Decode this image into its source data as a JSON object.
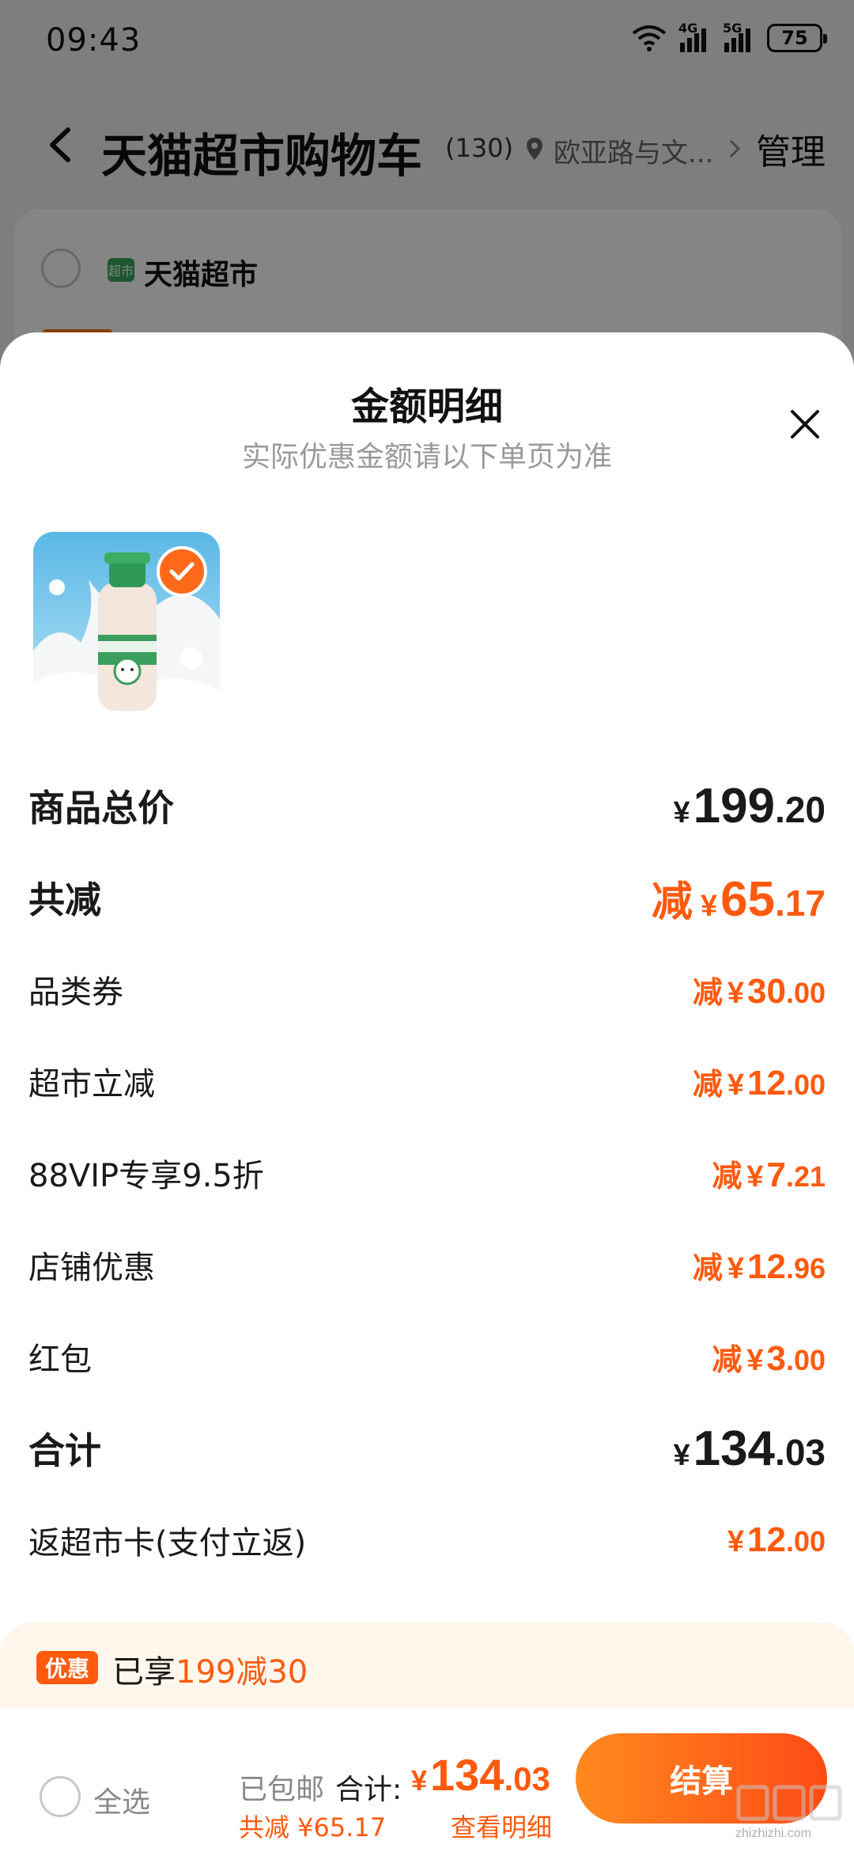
{
  "status_bar": {
    "time": "09:43",
    "net1": "4G",
    "net2": "5G",
    "battery": "75"
  },
  "nav": {
    "title": "天猫超市购物车",
    "count": "(130)",
    "location": "欧亚路与文...",
    "manage": "管理"
  },
  "store": {
    "logo_text": "超市",
    "name": "天猫超市"
  },
  "sheet": {
    "title": "金额明细",
    "subtitle": "实际优惠金额请以下单页为准"
  },
  "breakdown": {
    "subtotal": {
      "label": "商品总价",
      "prefix": "¥",
      "int": "199",
      "dec": ".20"
    },
    "discount_total": {
      "label": "共减",
      "jian": "减",
      "prefix": "¥",
      "int": "65",
      "dec": ".17"
    },
    "items": [
      {
        "label": "品类券",
        "jian": "减",
        "prefix": "¥",
        "int": "30",
        "dec": ".00"
      },
      {
        "label": "超市立减",
        "jian": "减",
        "prefix": "¥",
        "int": "12",
        "dec": ".00"
      },
      {
        "label": "88VIP专享9.5折",
        "jian": "减",
        "prefix": "¥",
        "int": "7",
        "dec": ".21"
      },
      {
        "label": "店铺优惠",
        "jian": "减",
        "prefix": "¥",
        "int": "12",
        "dec": ".96"
      },
      {
        "label": "红包",
        "jian": "减",
        "prefix": "¥",
        "int": "3",
        "dec": ".00"
      }
    ],
    "total": {
      "label": "合计",
      "prefix": "¥",
      "int": "134",
      "dec": ".03"
    },
    "cashback": {
      "label": "返超市卡(支付立返)",
      "prefix": "¥",
      "int": "12",
      "dec": ".00"
    }
  },
  "promo": {
    "badge": "优惠",
    "text_prefix": "已享",
    "highlight": "199减30"
  },
  "footer": {
    "select_all": "全选",
    "free_shipping": "已包邮",
    "total_label": "合计:",
    "total_prefix": "¥",
    "total_int": "134",
    "total_dec": ".03",
    "saved": "共减 ¥65.17",
    "view_detail": "查看明细",
    "checkout": "结算"
  },
  "watermark": "zhizhizhi.com",
  "colors": {
    "accent": "#ff5a0e",
    "overlay": "#7d7d7d"
  }
}
